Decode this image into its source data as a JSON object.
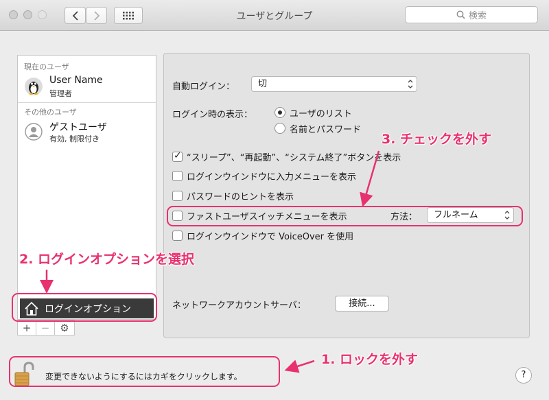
{
  "window": {
    "title": "ユーザとグループ"
  },
  "toolbar": {
    "search_placeholder": "検索"
  },
  "sidebar": {
    "current_header": "現在のユーザ",
    "current_user": {
      "name": "User Name",
      "role": "管理者"
    },
    "other_header": "その他のユーザ",
    "guest_user": {
      "name": "ゲストユーザ",
      "role": "有効, 制限付き"
    },
    "login_options": "ログインオプション",
    "add_label": "+",
    "remove_label": "−",
    "gear_label": "⚙"
  },
  "settings": {
    "auto_login_label": "自動ログイン：",
    "auto_login_value": "切",
    "display_label": "ログイン時の表示：",
    "radio_list_label": "ユーザのリスト",
    "radio_name_label": "名前とパスワード",
    "radio_selected": "list",
    "cb_sleep_label": "“スリープ”、“再起動”、“システム終了”ボタンを表示",
    "cb_sleep_checked": true,
    "cb_input_menu_label": "ログインウインドウに入力メニューを表示",
    "cb_input_menu_checked": false,
    "cb_hints_label": "パスワードのヒントを表示",
    "cb_hints_checked": false,
    "cb_fast_switch_label": "ファストユーザスイッチメニューを表示",
    "cb_fast_switch_checked": false,
    "method_label": "方法：",
    "method_value": "フルネーム",
    "cb_voiceover_label": "ログインウインドウで VoiceOver を使用",
    "cb_voiceover_checked": false,
    "network_label": "ネットワークアカウントサーバ：",
    "join_button": "接続..."
  },
  "footer": {
    "lock_text": "変更できないようにするにはカギをクリックします。",
    "help_label": "?"
  },
  "annotations": {
    "step1": "1. ロックを外す",
    "step2": "2. ログインオプションを選択",
    "step3": "3. チェックを外す",
    "color": "#e8316f"
  }
}
